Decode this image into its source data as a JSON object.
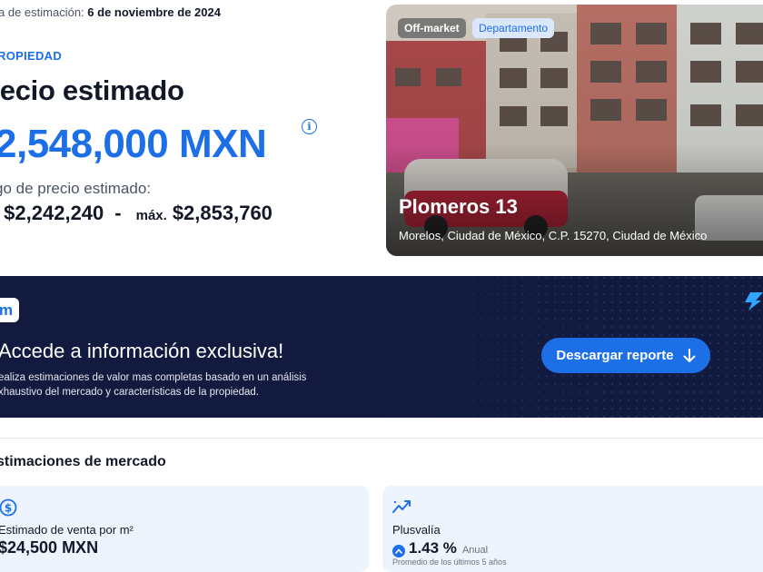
{
  "header": {
    "estimation_label": "a de estimación:",
    "estimation_date": "6 de noviembre de 2024"
  },
  "price": {
    "section_tag": "ROPIEDAD",
    "title": "recio estimado",
    "value": "2,548,000 MXN",
    "info_icon": "info-icon",
    "range_label": "go de precio estimado:",
    "min_label": ".",
    "min_value": "$2,242,240",
    "separator": "-",
    "max_label": "máx.",
    "max_value": "$2,853,760"
  },
  "property": {
    "badges": [
      "Off-market",
      "Departamento"
    ],
    "name": "Plomeros 13",
    "address": "Morelos, Ciudad de México, C.P. 15270, Ciudad de México"
  },
  "banner": {
    "logo_letter": "m",
    "title": "Accede a información exclusiva!",
    "desc_line1": "ealiza estimaciones de valor mas completas basado en un análisis",
    "desc_line2": "xhaustivo del mercado y características de la propiedad.",
    "button_label": "Descargar reporte",
    "button_icon": "arrow-down-icon",
    "accent_icon": "bolt-icon"
  },
  "market": {
    "title": "stimaciones de mercado",
    "cards": [
      {
        "icon": "dollar-circle-icon",
        "label": "Estimado de venta por m²",
        "value": "$24,500 MXN"
      },
      {
        "icon": "trend-up-icon",
        "label": "Plusvalía",
        "value": "1.43 %",
        "unit": "Anual",
        "note": "Promedio de los últimos 5 años"
      }
    ]
  },
  "colors": {
    "accent": "#1d6fe8",
    "banner_bg": "#131a3f",
    "card_bg": "#eef4fd"
  }
}
